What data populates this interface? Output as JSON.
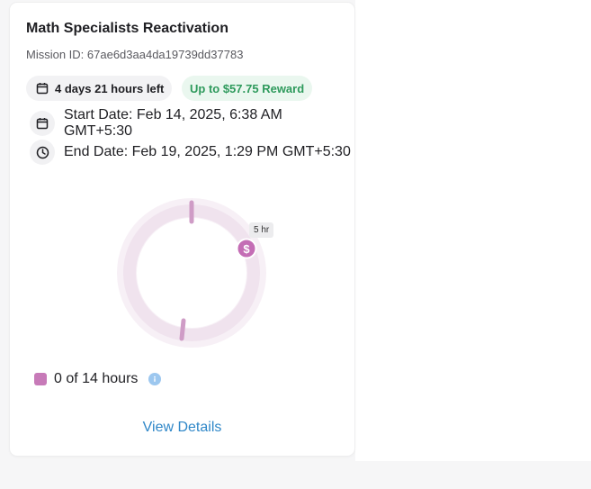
{
  "card": {
    "title": "Math Specialists Reactivation",
    "mission_id": "Mission ID: 67ae6d3aa4da19739dd37783",
    "time_left": "4 days 21 hours left",
    "reward": "Up to $57.75 Reward",
    "start_date": "Start Date: Feb 14, 2025, 6:38 AM GMT+5:30",
    "end_date": "End Date: Feb 19, 2025, 1:29 PM GMT+5:30",
    "progress": {
      "marker_label": "5 hr",
      "marker_icon": "dollar-icon",
      "legend_text": "0 of 14 hours",
      "completed_hours": 0,
      "total_hours": 14
    },
    "view_details": "View Details"
  },
  "colors": {
    "ring_track": "#f2e6f0",
    "ring_mark": "#c77ab8",
    "reward_text": "#2e9a5c",
    "reward_bg": "#eaf7ef",
    "link": "#2f87c8"
  }
}
